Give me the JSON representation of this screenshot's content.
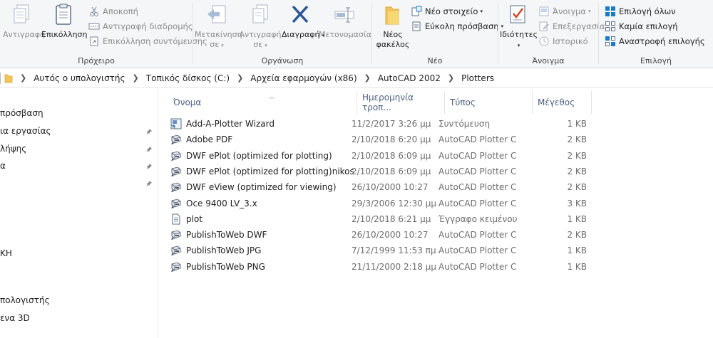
{
  "ribbon": {
    "clipboard": {
      "label": "Πρόχειρο",
      "copy": "Αντιγραφή",
      "paste": "Επικόλληση",
      "cut": "Αποκοπή",
      "copy_path": "Αντιγραφή διαδρομής",
      "paste_shortcut": "Επικόλληση συντόμευσης"
    },
    "organize": {
      "label": "Οργάνωση",
      "move_to_line1": "Μετακίνηση",
      "move_to_line2": "σε",
      "copy_to_line1": "Αντιγραφή",
      "copy_to_line2": "σε",
      "delete": "Διαγραφή",
      "rename": "Μετονομασία"
    },
    "new": {
      "label": "Νέο",
      "new_folder_line1": "Νέος",
      "new_folder_line2": "φακέλος",
      "new_item": "Νέο στοιχείο",
      "easy_access": "Εύκολη πρόσβαση"
    },
    "open": {
      "label": "Άνοιγμα",
      "properties": "Ιδιότητες",
      "open": "Άνοιγμα",
      "edit": "Επεξεργασία",
      "history": "Ιστορικό"
    },
    "select": {
      "label": "Επιλογή",
      "select_all": "Επιλογή όλων",
      "select_none": "Καμία επιλογή",
      "invert_selection": "Αναστροφή επιλογής"
    }
  },
  "address": {
    "crumbs": [
      "Αυτός ο υπολογιστής",
      "Τοπικός δίσκος (C:)",
      "Αρχεία εφαρμογών (x86)",
      "AutoCAD 2002",
      "Plotters"
    ]
  },
  "nav": {
    "items": [
      {
        "label": "πρόσβαση"
      },
      {
        "label": "ια εργασίας"
      },
      {
        "label": " λήψης"
      },
      {
        "label": "α"
      },
      {
        "label": "ΚΗ"
      },
      {
        "label": "πολογιστής"
      },
      {
        "label": "ενα 3D"
      }
    ]
  },
  "columns": {
    "name": "Όνομα",
    "date": "Ημερομηνία τροπ...",
    "type": "Τύπος",
    "size": "Μέγεθος"
  },
  "files": [
    {
      "name": "Add-A-Plotter Wizard",
      "date": "11/2/2017 3:26 μμ",
      "type": "Συντόμευση",
      "size": "1 KB",
      "icon": "shortcut-icon"
    },
    {
      "name": "Adobe PDF",
      "date": "2/10/2018 6:20 μμ",
      "type": "AutoCAD Plotter C...",
      "size": "2 KB",
      "icon": "plotter-config-icon"
    },
    {
      "name": "DWF ePlot (optimized for plotting)",
      "date": "2/10/2018 6:09 μμ",
      "type": "AutoCAD Plotter C...",
      "size": "2 KB",
      "icon": "plotter-config-icon"
    },
    {
      "name": "DWF ePlot (optimized for plotting)nikos",
      "date": "2/10/2018 6:09 μμ",
      "type": "AutoCAD Plotter C...",
      "size": "2 KB",
      "icon": "plotter-config-icon"
    },
    {
      "name": "DWF eView (optimized for viewing)",
      "date": "26/10/2000 10:27",
      "type": "AutoCAD Plotter C...",
      "size": "2 KB",
      "icon": "plotter-config-icon"
    },
    {
      "name": "Oce 9400 LV_3.x",
      "date": "29/3/2006 12:30 μμ",
      "type": "AutoCAD Plotter C...",
      "size": "3 KB",
      "icon": "plotter-config-icon"
    },
    {
      "name": "plot",
      "date": "2/10/2018 6:21 μμ",
      "type": "Έγγραφο κειμένου",
      "size": "1 KB",
      "icon": "text-document-icon"
    },
    {
      "name": "PublishToWeb DWF",
      "date": "26/10/2000 10:27",
      "type": "AutoCAD Plotter C...",
      "size": "2 KB",
      "icon": "plotter-config-icon"
    },
    {
      "name": "PublishToWeb JPG",
      "date": "7/12/1999 11:53 πμ",
      "type": "AutoCAD Plotter C...",
      "size": "1 KB",
      "icon": "plotter-config-icon"
    },
    {
      "name": "PublishToWeb PNG",
      "date": "21/11/2000 2:18 μμ",
      "type": "AutoCAD Plotter C...",
      "size": "1 KB",
      "icon": "plotter-config-icon"
    }
  ],
  "colors": {
    "accent": "#1979ca",
    "header_text": "#4d6082",
    "folder_yellow": "#f2c55c",
    "delete_blue": "#2b5797"
  }
}
